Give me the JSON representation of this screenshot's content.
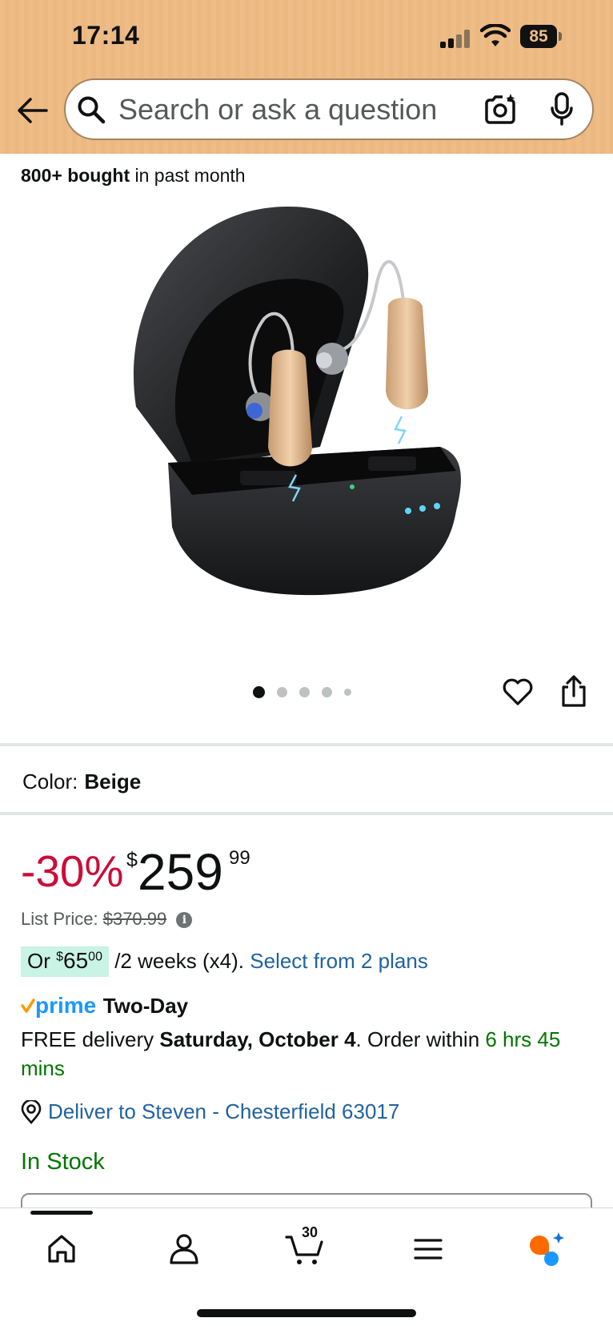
{
  "status_bar": {
    "time": "17:14",
    "battery": "85"
  },
  "header": {
    "search_placeholder": "Search or ask a question"
  },
  "product": {
    "social_proof_bold": "800+ bought",
    "social_proof_rest": " in past month",
    "image_count": 5,
    "active_image": 1
  },
  "variation": {
    "label": "Color:",
    "value": "Beige"
  },
  "price": {
    "discount": "-30%",
    "currency": "$",
    "whole": "259",
    "fraction": "99",
    "list_label": "List Price:",
    "list_value": "$370.99",
    "info_icon": "i"
  },
  "installments": {
    "prefix": "Or ",
    "currency": "$",
    "amount": "65",
    "fraction": "00",
    "terms": " /2 weeks (x4).",
    "link": "Select from 2 plans"
  },
  "shipping": {
    "prime_label": "prime",
    "speed": "Two-Day",
    "free_text": "FREE delivery ",
    "date": "Saturday, October 4",
    "order_within_prefix": ". Order within ",
    "countdown": "6 hrs 45 mins"
  },
  "location": {
    "deliver_to": "Deliver to Steven - Chesterfield 63017"
  },
  "availability": {
    "status": "In Stock"
  },
  "bottom_nav": {
    "cart_count": "30",
    "items": [
      "home-icon",
      "account-icon",
      "cart-icon",
      "menu-icon",
      "rufus-icon"
    ]
  },
  "colors": {
    "header_bg": "#eebc86",
    "deal_red": "#cc0c39",
    "link_blue": "#2162a1",
    "stock_green": "#007600",
    "prime_blue": "#1a98ff",
    "installment_bg": "#c9f3e5"
  }
}
